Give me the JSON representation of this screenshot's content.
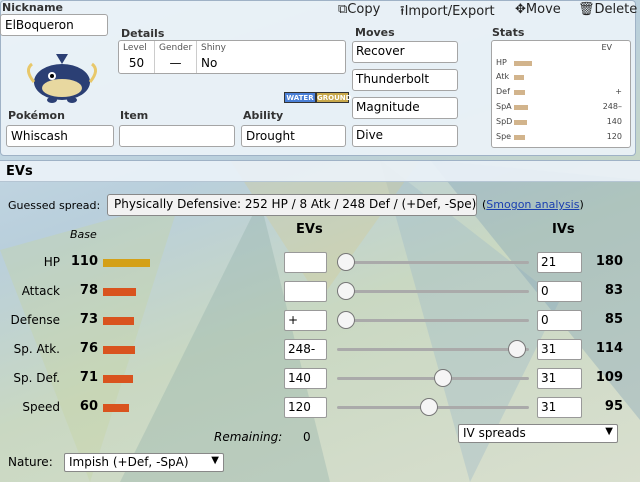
{
  "toolbar": {
    "nickname_label": "Nickname",
    "copy": "Copy",
    "import_export": "Import/Export",
    "move": "Move",
    "delete": "Delete"
  },
  "set": {
    "nickname": "ElBoqueron",
    "details": {
      "label": "Details",
      "level_label": "Level",
      "level": "50",
      "gender_label": "Gender",
      "gender": "—",
      "shiny_label": "Shiny",
      "shiny": "No"
    },
    "types": [
      "WATER",
      "GROUND"
    ],
    "pokemon_label": "Pokémon",
    "pokemon": "Whiscash",
    "item_label": "Item",
    "item": "",
    "ability_label": "Ability",
    "ability": "Drought",
    "moves_label": "Moves",
    "moves": [
      "Recover",
      "Thunderbolt",
      "Magnitude",
      "Dive"
    ],
    "stats_label": "Stats",
    "stats_ev_header": "EV",
    "stats": [
      {
        "name": "HP",
        "ev": ""
      },
      {
        "name": "Atk",
        "ev": ""
      },
      {
        "name": "Def",
        "ev": "+"
      },
      {
        "name": "SpA",
        "ev": "248–"
      },
      {
        "name": "SpD",
        "ev": "140"
      },
      {
        "name": "Spe",
        "ev": "120"
      }
    ]
  },
  "evs": {
    "title": "EVs",
    "guessed_label": "Guessed spread:",
    "guessed_value": "Physically Defensive: 252 HP / 8 Atk / 248 Def / (+Def, -Spe)",
    "guessed_paren_open": "(",
    "smogon_link": "Smogon analysis",
    "guessed_paren_close": ")",
    "base_header": "Base",
    "evs_header": "EVs",
    "ivs_header": "IVs",
    "rows": [
      {
        "name": "HP",
        "base": "110",
        "ev": "",
        "iv": "21",
        "total": "180",
        "ev_fraction": 0.0,
        "color": "#d4a017"
      },
      {
        "name": "Attack",
        "base": "78",
        "ev": "",
        "iv": "0",
        "total": "83",
        "ev_fraction": 0.0,
        "color": "#d9531e"
      },
      {
        "name": "Defense",
        "base": "73",
        "ev": "+",
        "iv": "0",
        "total": "85",
        "ev_fraction": 0.0,
        "color": "#d9531e"
      },
      {
        "name": "Sp. Atk.",
        "base": "76",
        "ev": "248-",
        "iv": "31",
        "total": "114",
        "ev_fraction": 0.984,
        "color": "#d9531e"
      },
      {
        "name": "Sp. Def.",
        "base": "71",
        "ev": "140",
        "iv": "31",
        "total": "109",
        "ev_fraction": 0.556,
        "color": "#d9531e"
      },
      {
        "name": "Speed",
        "base": "60",
        "ev": "120",
        "iv": "31",
        "total": "95",
        "ev_fraction": 0.476,
        "color": "#d9531e"
      }
    ],
    "remaining_label": "Remaining:",
    "remaining_value": "0",
    "iv_spreads": "IV spreads",
    "nature_label": "Nature:",
    "nature_value": "Impish (+Def, -SpA)"
  }
}
